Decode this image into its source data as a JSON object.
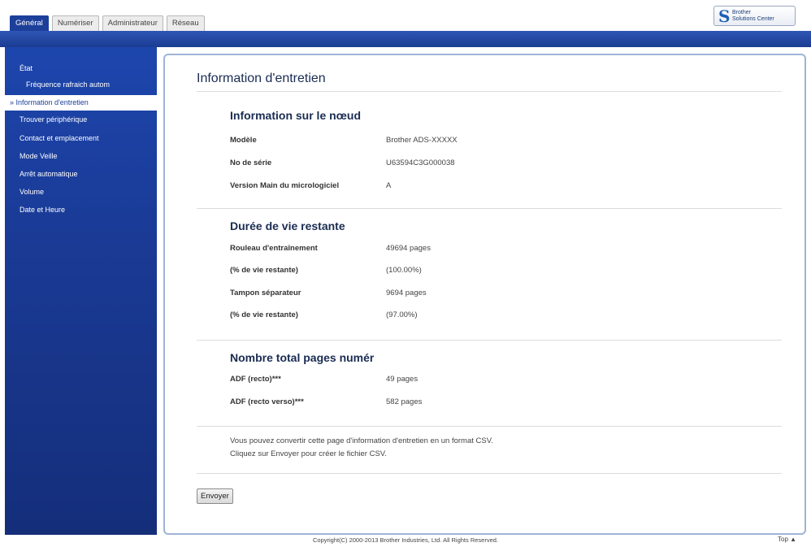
{
  "tabs": [
    {
      "label": "Général",
      "active": true
    },
    {
      "label": "Numériser",
      "active": false
    },
    {
      "label": "Administrateur",
      "active": false
    },
    {
      "label": "Réseau",
      "active": false
    }
  ],
  "logo": {
    "line1": "Brother",
    "line2": "Solutions Center",
    "mark": "S"
  },
  "sidebar": {
    "items": [
      {
        "label": "État",
        "sub": false,
        "active": false
      },
      {
        "label": "Fréquence rafraich autom",
        "sub": true,
        "active": false
      },
      {
        "label": "» Information d'entretien",
        "sub": false,
        "active": true
      },
      {
        "label": "Trouver périphérique",
        "sub": false,
        "active": false
      },
      {
        "label": "Contact et emplacement",
        "sub": false,
        "active": false
      },
      {
        "label": "Mode Veille",
        "sub": false,
        "active": false
      },
      {
        "label": "Arrêt automatique",
        "sub": false,
        "active": false
      },
      {
        "label": "Volume",
        "sub": false,
        "active": false
      },
      {
        "label": "Date et Heure",
        "sub": false,
        "active": false
      }
    ]
  },
  "main": {
    "title": "Information d'entretien",
    "node_section": {
      "title": "Information sur le nœud",
      "rows": [
        {
          "label": "Modèle",
          "value": "Brother ADS-XXXXX"
        },
        {
          "label": "No de série",
          "value": "U63594C3G000038"
        },
        {
          "label": "Version Main du micrologiciel",
          "value": "A"
        }
      ]
    },
    "life_section": {
      "title": "Durée de vie restante",
      "rows": [
        {
          "label": "Rouleau d'entraînement",
          "value": "49694 pages"
        },
        {
          "label": "(% de vie restante)",
          "value": "(100.00%)"
        },
        {
          "label": "Tampon séparateur",
          "value": "9694 pages"
        },
        {
          "label": "(% de vie restante)",
          "value": "(97.00%)"
        }
      ]
    },
    "total_section": {
      "title": "Nombre total pages numér",
      "rows": [
        {
          "label": "ADF (recto)***",
          "value": "49 pages"
        },
        {
          "label": "ADF (recto verso)***",
          "value": "582 pages"
        }
      ]
    },
    "info_line1": "Vous pouvez convertir cette page d'information d'entretien en un format CSV.",
    "info_line2": "Cliquez sur Envoyer pour créer le fichier CSV.",
    "send_label": "Envoyer"
  },
  "footer": {
    "copyright": "Copyright(C) 2000-2013 Brother Industries, Ltd. All Rights Reserved.",
    "top_label": "Top ▲"
  }
}
